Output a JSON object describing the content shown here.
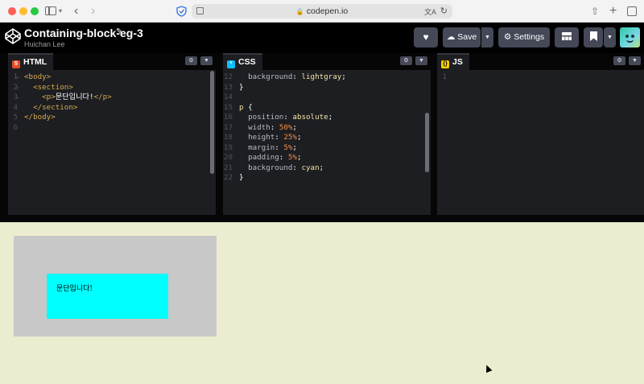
{
  "browser": {
    "url": "codepen.io"
  },
  "pen": {
    "title": "Containing-block-eg-3",
    "author": "Huichan Lee"
  },
  "header": {
    "save_label": "Save",
    "settings_label": "Settings"
  },
  "editors": {
    "html": {
      "label": "HTML",
      "lines": [
        {
          "n": "1",
          "fold": "▾",
          "tokens": [
            {
              "c": "t-tag",
              "t": "<body>"
            }
          ]
        },
        {
          "n": "2",
          "fold": "▾",
          "tokens": [
            {
              "c": "t-tag",
              "t": "  <section>"
            }
          ]
        },
        {
          "n": "3",
          "fold": "▸",
          "tokens": [
            {
              "c": "t-tag",
              "t": "    <p>"
            },
            {
              "c": "t-txt",
              "t": "문단입니다!"
            },
            {
              "c": "t-tag",
              "t": "</p>"
            }
          ]
        },
        {
          "n": "4",
          "fold": " ",
          "tokens": [
            {
              "c": "t-tag",
              "t": "  </section>"
            }
          ]
        },
        {
          "n": "5",
          "fold": " ",
          "tokens": [
            {
              "c": "t-tag",
              "t": "</body>"
            }
          ]
        },
        {
          "n": "6",
          "fold": " ",
          "tokens": []
        }
      ]
    },
    "css": {
      "label": "CSS",
      "lines": [
        {
          "n": "12",
          "fold": " ",
          "tokens": [
            {
              "c": "t-prop",
              "t": "  background"
            },
            {
              "c": "t-pun",
              "t": ": "
            },
            {
              "c": "t-val",
              "t": "lightgray"
            },
            {
              "c": "t-pun",
              "t": ";"
            }
          ]
        },
        {
          "n": "13",
          "fold": " ",
          "tokens": [
            {
              "c": "t-pun",
              "t": "}"
            }
          ]
        },
        {
          "n": "14",
          "fold": " ",
          "tokens": []
        },
        {
          "n": "15",
          "fold": " ",
          "tokens": [
            {
              "c": "t-sel",
              "t": "p"
            },
            {
              "c": "t-pun",
              "t": " {"
            }
          ]
        },
        {
          "n": "16",
          "fold": " ",
          "tokens": [
            {
              "c": "t-prop",
              "t": "  position"
            },
            {
              "c": "t-pun",
              "t": ": "
            },
            {
              "c": "t-val",
              "t": "absolute"
            },
            {
              "c": "t-pun",
              "t": ";"
            }
          ]
        },
        {
          "n": "17",
          "fold": " ",
          "tokens": [
            {
              "c": "t-prop",
              "t": "  width"
            },
            {
              "c": "t-pun",
              "t": ": "
            },
            {
              "c": "t-num",
              "t": "50%"
            },
            {
              "c": "t-pun",
              "t": ";"
            }
          ]
        },
        {
          "n": "18",
          "fold": " ",
          "tokens": [
            {
              "c": "t-prop",
              "t": "  height"
            },
            {
              "c": "t-pun",
              "t": ": "
            },
            {
              "c": "t-num",
              "t": "25%"
            },
            {
              "c": "t-pun",
              "t": ";"
            }
          ]
        },
        {
          "n": "19",
          "fold": " ",
          "tokens": [
            {
              "c": "t-prop",
              "t": "  margin"
            },
            {
              "c": "t-pun",
              "t": ": "
            },
            {
              "c": "t-num",
              "t": "5%"
            },
            {
              "c": "t-pun",
              "t": ";"
            }
          ]
        },
        {
          "n": "20",
          "fold": " ",
          "tokens": [
            {
              "c": "t-prop",
              "t": "  padding"
            },
            {
              "c": "t-pun",
              "t": ": "
            },
            {
              "c": "t-num",
              "t": "5%"
            },
            {
              "c": "t-pun",
              "t": ";"
            }
          ]
        },
        {
          "n": "21",
          "fold": " ",
          "tokens": [
            {
              "c": "t-prop",
              "t": "  background"
            },
            {
              "c": "t-pun",
              "t": ": "
            },
            {
              "c": "t-val",
              "t": "cyan"
            },
            {
              "c": "t-pun",
              "t": ";"
            }
          ]
        },
        {
          "n": "22",
          "fold": " ",
          "tokens": [
            {
              "c": "t-pun",
              "t": "}"
            }
          ]
        }
      ]
    },
    "js": {
      "label": "JS",
      "lines": [
        {
          "n": "1",
          "fold": " ",
          "tokens": []
        }
      ]
    }
  },
  "preview": {
    "paragraph_text": "문단입니다!",
    "section_color": "#c8c8c8",
    "paragraph_color": "#00ffff",
    "page_bg": "#ececd0"
  },
  "colors": {
    "html_badge": "#e44d26",
    "css_badge": "#0ebeff",
    "js_badge": "#fcd000"
  }
}
